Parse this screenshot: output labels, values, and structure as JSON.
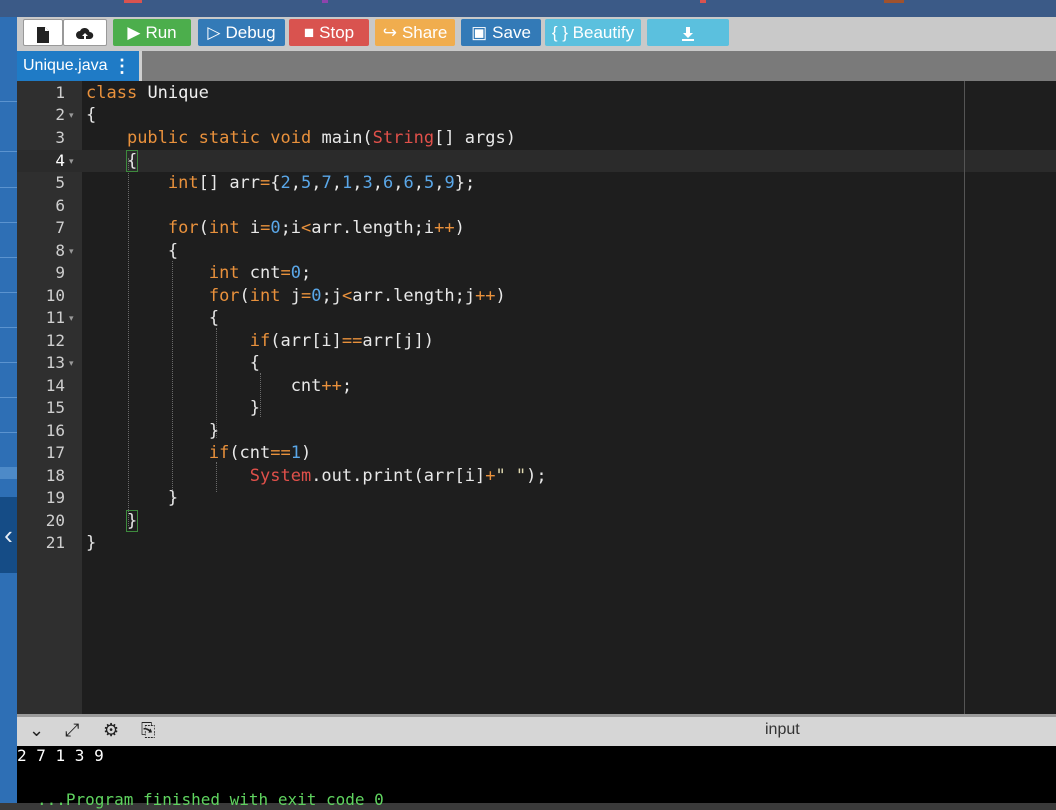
{
  "toolbar": {
    "run": "Run",
    "debug": "Debug",
    "stop": "Stop",
    "share": "Share",
    "save": "Save",
    "beautify": "{ } Beautify"
  },
  "tab": {
    "filename": "Unique.java"
  },
  "editor": {
    "line_numbers": [
      "1",
      "2",
      "3",
      "4",
      "5",
      "6",
      "7",
      "8",
      "9",
      "10",
      "11",
      "12",
      "13",
      "14",
      "15",
      "16",
      "17",
      "18",
      "19",
      "20",
      "21"
    ]
  },
  "bottom": {
    "input_label": "input"
  },
  "console": {
    "output": "2 7 1 3 9",
    "exit_message": "...Program finished with exit code 0"
  },
  "colors": {
    "run": "#4cae4c",
    "debug": "#337ab7",
    "stop": "#d9534f",
    "share": "#f0ad4e",
    "save": "#337ab7",
    "beautify": "#5bc0de",
    "tab": "#1f7bc6"
  }
}
